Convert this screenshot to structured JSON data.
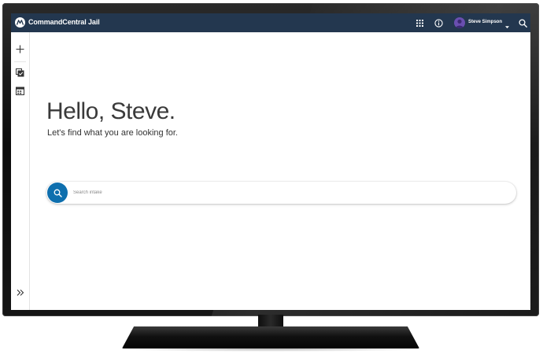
{
  "header": {
    "app_title": "CommandCentral Jail",
    "user_name": "Steve Simpson",
    "icons": [
      "motorola-logo-icon",
      "apps-grid-icon",
      "info-icon",
      "avatar",
      "chevron-down-icon",
      "search-icon"
    ]
  },
  "sidebar": {
    "items": [
      {
        "icon": "plus-icon"
      },
      {
        "icon": "tasks-icon"
      },
      {
        "icon": "calendar-icon"
      },
      {
        "icon": "double-chevron-right-icon"
      }
    ]
  },
  "main": {
    "greeting": "Hello, Steve.",
    "subheading": "Let's find what you are looking for.",
    "search": {
      "placeholder": "Search intake",
      "value": ""
    }
  },
  "colors": {
    "header_bg": "#23374f",
    "accent": "#0e6fae",
    "text_dark": "#3a3a3a",
    "avatar": "#6a4fb0"
  }
}
